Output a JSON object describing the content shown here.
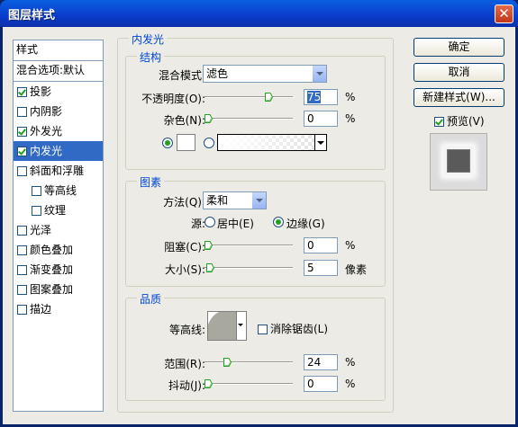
{
  "window": {
    "title": "图层样式",
    "close_glyph": "✕"
  },
  "style_list": {
    "header": "样式",
    "blend_options": "混合选项:默认",
    "items": [
      {
        "label": "投影",
        "checked": true
      },
      {
        "label": "内阴影",
        "checked": false
      },
      {
        "label": "外发光",
        "checked": true
      },
      {
        "label": "内发光",
        "checked": true,
        "selected": true
      },
      {
        "label": "斜面和浮雕",
        "checked": false
      },
      {
        "label": "等高线",
        "checked": false,
        "sub": true
      },
      {
        "label": "纹理",
        "checked": false,
        "sub": true
      },
      {
        "label": "光泽",
        "checked": false
      },
      {
        "label": "颜色叠加",
        "checked": false
      },
      {
        "label": "渐变叠加",
        "checked": false
      },
      {
        "label": "图案叠加",
        "checked": false
      },
      {
        "label": "描边",
        "checked": false
      }
    ]
  },
  "buttons": {
    "ok": "确定",
    "cancel": "取消",
    "new_style": "新建样式(W)...",
    "preview": "预览(V)",
    "preview_checked": true
  },
  "panel": {
    "title": "内发光",
    "structure": {
      "title": "结构",
      "blend_mode_label": "混合模式:",
      "blend_mode_value": "滤色",
      "opacity_label": "不透明度(O):",
      "opacity_value": "75",
      "opacity_level": 0.75,
      "noise_label": "杂色(N):",
      "noise_value": "0",
      "noise_level": 0,
      "percent": "%"
    },
    "elements": {
      "title": "图素",
      "technique_label": "方法(Q):",
      "technique_value": "柔和",
      "source_label": "源:",
      "source_center": "居中(E)",
      "source_edge": "边缘(G)",
      "choke_label": "阻塞(C):",
      "choke_value": "0",
      "choke_level": 0,
      "size_label": "大小(S):",
      "size_value": "5",
      "size_unit": "像素",
      "size_level": 0.02,
      "percent": "%"
    },
    "quality": {
      "title": "品质",
      "contour_label": "等高线:",
      "antialias_label": "消除锯齿(L)",
      "range_label": "范围(R):",
      "range_value": "24",
      "range_level": 0.24,
      "jitter_label": "抖动(J):",
      "jitter_value": "0",
      "jitter_level": 0,
      "percent": "%"
    }
  },
  "colors": {
    "accent_blue": "#316ac5",
    "group_title_blue": "#0046d5",
    "preview_swatch": "#5a5a5a"
  }
}
